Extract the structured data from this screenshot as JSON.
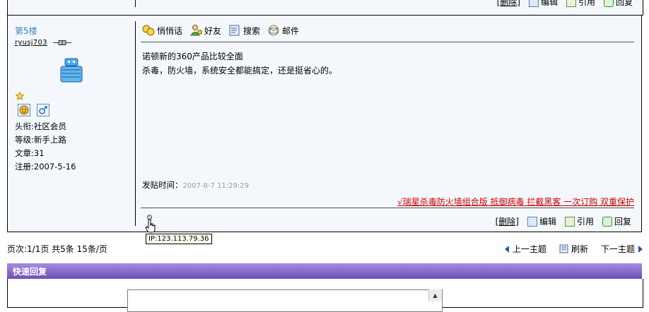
{
  "prev_post": {
    "actions": [
      "[删除]",
      "编辑",
      "引用",
      "回复"
    ]
  },
  "post": {
    "floor": "第5楼",
    "username": "ryusj703",
    "info": {
      "title_label": "头衔:",
      "title_value": "社区会员",
      "level_label": "等级:",
      "level_value": "新手上路",
      "articles_label": "文章:",
      "articles_value": "31",
      "register_label": "注册:",
      "register_value": "2007-5-16"
    },
    "toolbar": {
      "whisper": "悄悄话",
      "friend": "好友",
      "search": "搜索",
      "mail": "邮件"
    },
    "content": {
      "line1": "诺顿新的360产品比较全面",
      "line2": "杀毒，防火墙，系统安全都能搞定，还是挺省心的。"
    },
    "post_time_label": "发贴时间：",
    "post_time_value": "2007-8-7 11:29:29",
    "ad_link": "√瑞星杀毒防火墙组合版 抵御病毒 拦截黑客 一次订购 双重保护",
    "actions": {
      "delete": "[删除]",
      "edit": "编辑",
      "quote": "引用",
      "reply": "回复"
    },
    "ip_tooltip": "IP:123.113.79.36"
  },
  "pagination": {
    "info": "页次:1/1页 共5条 15条/页",
    "prev_topic": "上一主题",
    "refresh": "刷新",
    "next_topic": "下一主题"
  },
  "quick_reply": {
    "title": "快速回复"
  }
}
